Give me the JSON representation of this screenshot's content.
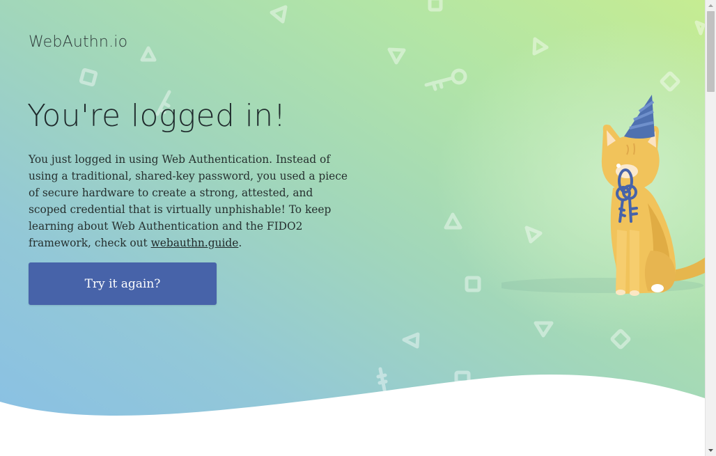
{
  "brand": "WebAuthn.io",
  "title": "You're logged in!",
  "body": {
    "text": "You just logged in using Web Authentication. Instead of using a traditional, shared-key password, you used a piece of secure hardware to create a strong, attested, and scoped credential that is virtually unphishable! To keep learning about Web Authentication and the FIDO2 framework, check out ",
    "link_text": "webauthn.guide",
    "trailing": "."
  },
  "button": {
    "label": "Try it again?"
  },
  "illustration": {
    "subject": "cat-with-party-hat-holding-keys-icon"
  },
  "colors": {
    "button": "#4763a9",
    "text": "#1f2a2c",
    "gradient_top_right": "#c6ec92",
    "gradient_bottom_left": "#88bfe6"
  }
}
